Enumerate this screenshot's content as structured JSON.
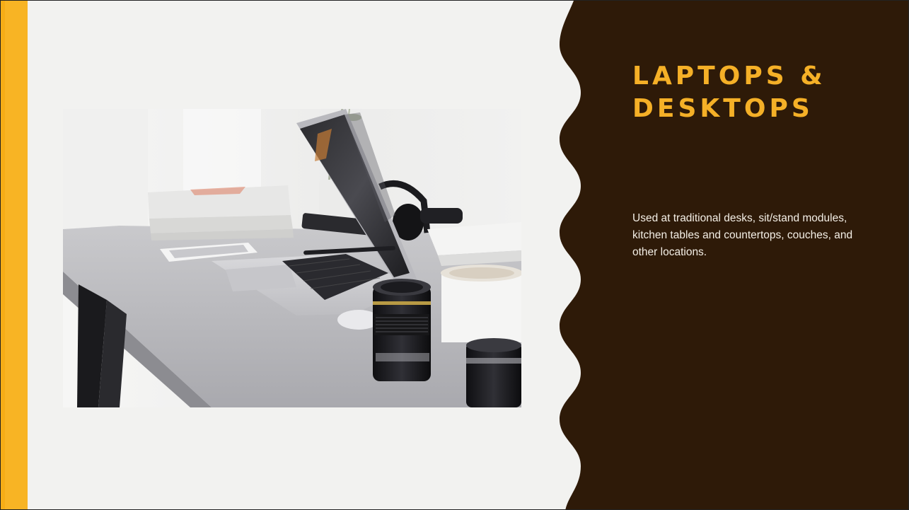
{
  "slide": {
    "title": "LAPTOPS &\nDESKTOPS",
    "body": "Used at traditional desks,  sit/stand modules, kitchen tables and countertops, couches, and other locations."
  },
  "colors": {
    "accent": "#f8b424",
    "panel": "#2e1a08",
    "background": "#f2f2f0",
    "title": "#f5b027",
    "body_text": "#f4efe6"
  }
}
